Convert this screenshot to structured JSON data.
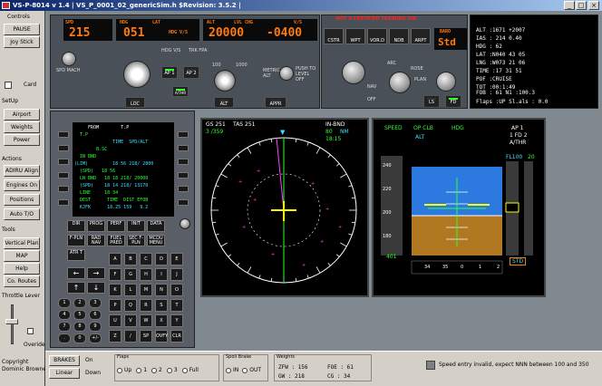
{
  "window": {
    "title": "VS-P-8014 v 1.4 | VS_P_0001_02_genericSim.h $Revision: 3.5.2 |"
  },
  "sidebar": {
    "controls": "Controls",
    "pause": "PAUSE",
    "joy": "Joy Stick",
    "card": "Card",
    "setup": "SetUp",
    "airport": "Airport",
    "weights": "Weights",
    "power": "Power",
    "actions": "Actions",
    "adiru": "ADIRU Align",
    "engines": "Engines On",
    "positions": "Positions",
    "autoto": "Auto T/O",
    "tools": "Tools",
    "vplan": "Vertical Plan",
    "map": "MAP",
    "help": "Help",
    "co_routes": "Co. Routes",
    "throttle": "Throttle Lever",
    "override": "Overide",
    "copyright": "Copyright\nDominic Browne"
  },
  "fcu": {
    "spd_lbl": "SPD",
    "mach_lbl": "MACH",
    "spd": "215",
    "hdg_lbl": "HDG",
    "lat_lbl": "LAT",
    "hdg": "051",
    "hdgvs": "HDG V/S",
    "trk": "TRK FPA",
    "alt_lbl": "ALT",
    "lvl_lbl": "LVL CHG",
    "vs_lbl": "V/S",
    "alt": "20000",
    "vs": "-0400",
    "loc": "LOC",
    "ap1": "AP 1",
    "ap2": "AP 2",
    "athr": "A/THR",
    "altbtn": "ALT",
    "appr": "APPR",
    "alt100": "100",
    "alt1000": "1000",
    "metric": "METRIC ALT",
    "push": "PUSH TO LEVEL OFF",
    "spdmach": "SPD MACH"
  },
  "efis": {
    "banner": "NOT A CERTIFIED TRAINING AID",
    "cstr": "CSTR",
    "wpt": "WPT",
    "vord": "VOR.D",
    "ndb": "NDB",
    "arpt": "ARPT",
    "baro_lbl": "BARO",
    "baro": "Std",
    "ls": "LS",
    "fd": "FD",
    "nav": "NAV",
    "arc": "ARC",
    "rose": "ROSE",
    "plan": "PLAN",
    "off": "OFF"
  },
  "ecam": {
    "lines": [
      "ALT   :1671 +2007",
      "IAS   : 214 0.40",
      "HDG   : 62",
      "LAT   :N040 43 05",
      "LNG   :W073 21 06",
      "TIME  :17 31 51",
      "POF   :CRUISE",
      "TOT   :00:1:49"
    ],
    "fob": "FOB  : 61    N1 :100.3",
    "flaps": "Flaps :UP    Sl.als : 0.0"
  },
  "mcdu": {
    "lines": [
      "     FROM        T.P",
      "",
      "  T.P",
      "              TIME  SPD/ALT",
      "        B.SC              ",
      "  IN BND         ",
      "(LIM)         18 56 218/ 2800",
      "  (SPD)   18 56  ",
      "  LN BND   18 18 218/ 20000",
      "  (SPD)    18 14 218/ 13170",
      "  LINE     18 34",
      "  DEST      TIME  DIST EFOB",
      "  KJFK      18.25 159   9.2"
    ],
    "keys": [
      "DIR",
      "PROG",
      "PERF",
      "INIT",
      "DATA",
      "F-PLN",
      "RAD NAV",
      "FUEL PRED",
      "SEC F-PLN",
      "MCDU MENU",
      "ATR T"
    ],
    "letters": [
      "A",
      "B",
      "C",
      "D",
      "E",
      "F",
      "G",
      "H",
      "I",
      "J",
      "K",
      "L",
      "M",
      "N",
      "O",
      "P",
      "Q",
      "R",
      "S",
      "T",
      "U",
      "V",
      "W",
      "X",
      "Y",
      "Z",
      "/",
      "SP",
      "OVFY",
      "CLR"
    ],
    "digits": [
      "1",
      "2",
      "3",
      "4",
      "5",
      "6",
      "7",
      "8",
      "9",
      ".",
      "0",
      "+/-"
    ]
  },
  "nd": {
    "gs": "GS 251",
    "tas": "TAS 251",
    "wind": "3   /359",
    "inbnd": "IN-BND",
    "dist": "80",
    "nm": "NM",
    "time": "18:15",
    "ring": "80"
  },
  "pfd": {
    "fma1": "SPEED",
    "fma2": "OP CLB",
    "fma3": "HDG",
    "fma4": "AP 1",
    "fma5": "1 FD 2",
    "fma6": "A/THR",
    "alt_fma": "ALT",
    "fl": "FL100",
    "fl2": "20",
    "spd_bot": "401",
    "qnh": "STD",
    "hdg": [
      "34",
      "35",
      "0",
      "1",
      "2"
    ],
    "spd_ticks": [
      "240",
      "220",
      "200",
      "180"
    ]
  },
  "status": {
    "brakes": "BRAKES",
    "brakes_on": "On",
    "brakes_mode": "Linear",
    "brakes_down": "Down",
    "flaps_lbl": "Flaps",
    "flaps": [
      "Up",
      "1",
      "2",
      "3",
      "Full"
    ],
    "spoil_lbl": "Spoil Brake",
    "spoil": [
      "IN",
      "OUT"
    ],
    "weights_lbl": "Weights",
    "zfw": "ZFW  :  156",
    "gw": "GW   :  218",
    "foe": "FOE  :   61",
    "cg": "CG  :   34",
    "msg": "Speed entry invalid, expect NNN between 100 and 350"
  },
  "colors": {
    "magenta": "#ff40ff",
    "cyan": "#40e0ff",
    "green": "#30ff30",
    "orange": "#ff7a10"
  }
}
